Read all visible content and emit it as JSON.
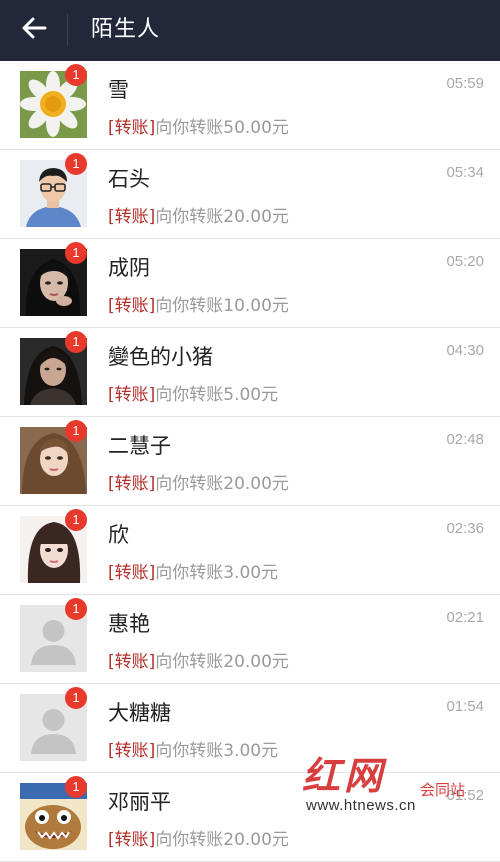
{
  "header": {
    "title": "陌生人",
    "background": "#22283a"
  },
  "colors": {
    "badge": "#e83a2c",
    "transfer_tag": "#b3312c",
    "message_text": "#9a9a9a",
    "time_text": "#a8a8a8"
  },
  "conversations": [
    {
      "name": "雪",
      "tag": "[转账]",
      "message": "向你转账50.00元",
      "time": "05:59",
      "unread": "1",
      "avatar": "daisy-photo"
    },
    {
      "name": "石头",
      "tag": "[转账]",
      "message": "向你转账20.00元",
      "time": "05:34",
      "unread": "1",
      "avatar": "man-glasses-photo"
    },
    {
      "name": "成阴",
      "tag": "[转账]",
      "message": "向你转账10.00元",
      "time": "05:20",
      "unread": "1",
      "avatar": "woman-portrait-photo"
    },
    {
      "name": "變色的小猪",
      "tag": "[转账]",
      "message": "向你转账5.00元",
      "time": "04:30",
      "unread": "1",
      "avatar": "woman-dark-photo"
    },
    {
      "name": "二慧子",
      "tag": "[转账]",
      "message": "向你转账20.00元",
      "time": "02:48",
      "unread": "1",
      "avatar": "woman-selfie-photo"
    },
    {
      "name": "欣",
      "tag": "[转账]",
      "message": "向你转账3.00元",
      "time": "02:36",
      "unread": "1",
      "avatar": "woman-bangs-photo"
    },
    {
      "name": "惠艳",
      "tag": "[转账]",
      "message": "向你转账20.00元",
      "time": "02:21",
      "unread": "1",
      "avatar": "default-user-icon"
    },
    {
      "name": "大糖糖",
      "tag": "[转账]",
      "message": "向你转账3.00元",
      "time": "01:54",
      "unread": "1",
      "avatar": "default-user-icon"
    },
    {
      "name": "邓丽平",
      "tag": "[转账]",
      "message": "向你转账20.00元",
      "time": "01:52",
      "unread": "1",
      "avatar": "cartoon-monster-image"
    }
  ],
  "watermark": {
    "logo": "红网",
    "sub": "会同站",
    "url": "www.htnews.cn"
  }
}
